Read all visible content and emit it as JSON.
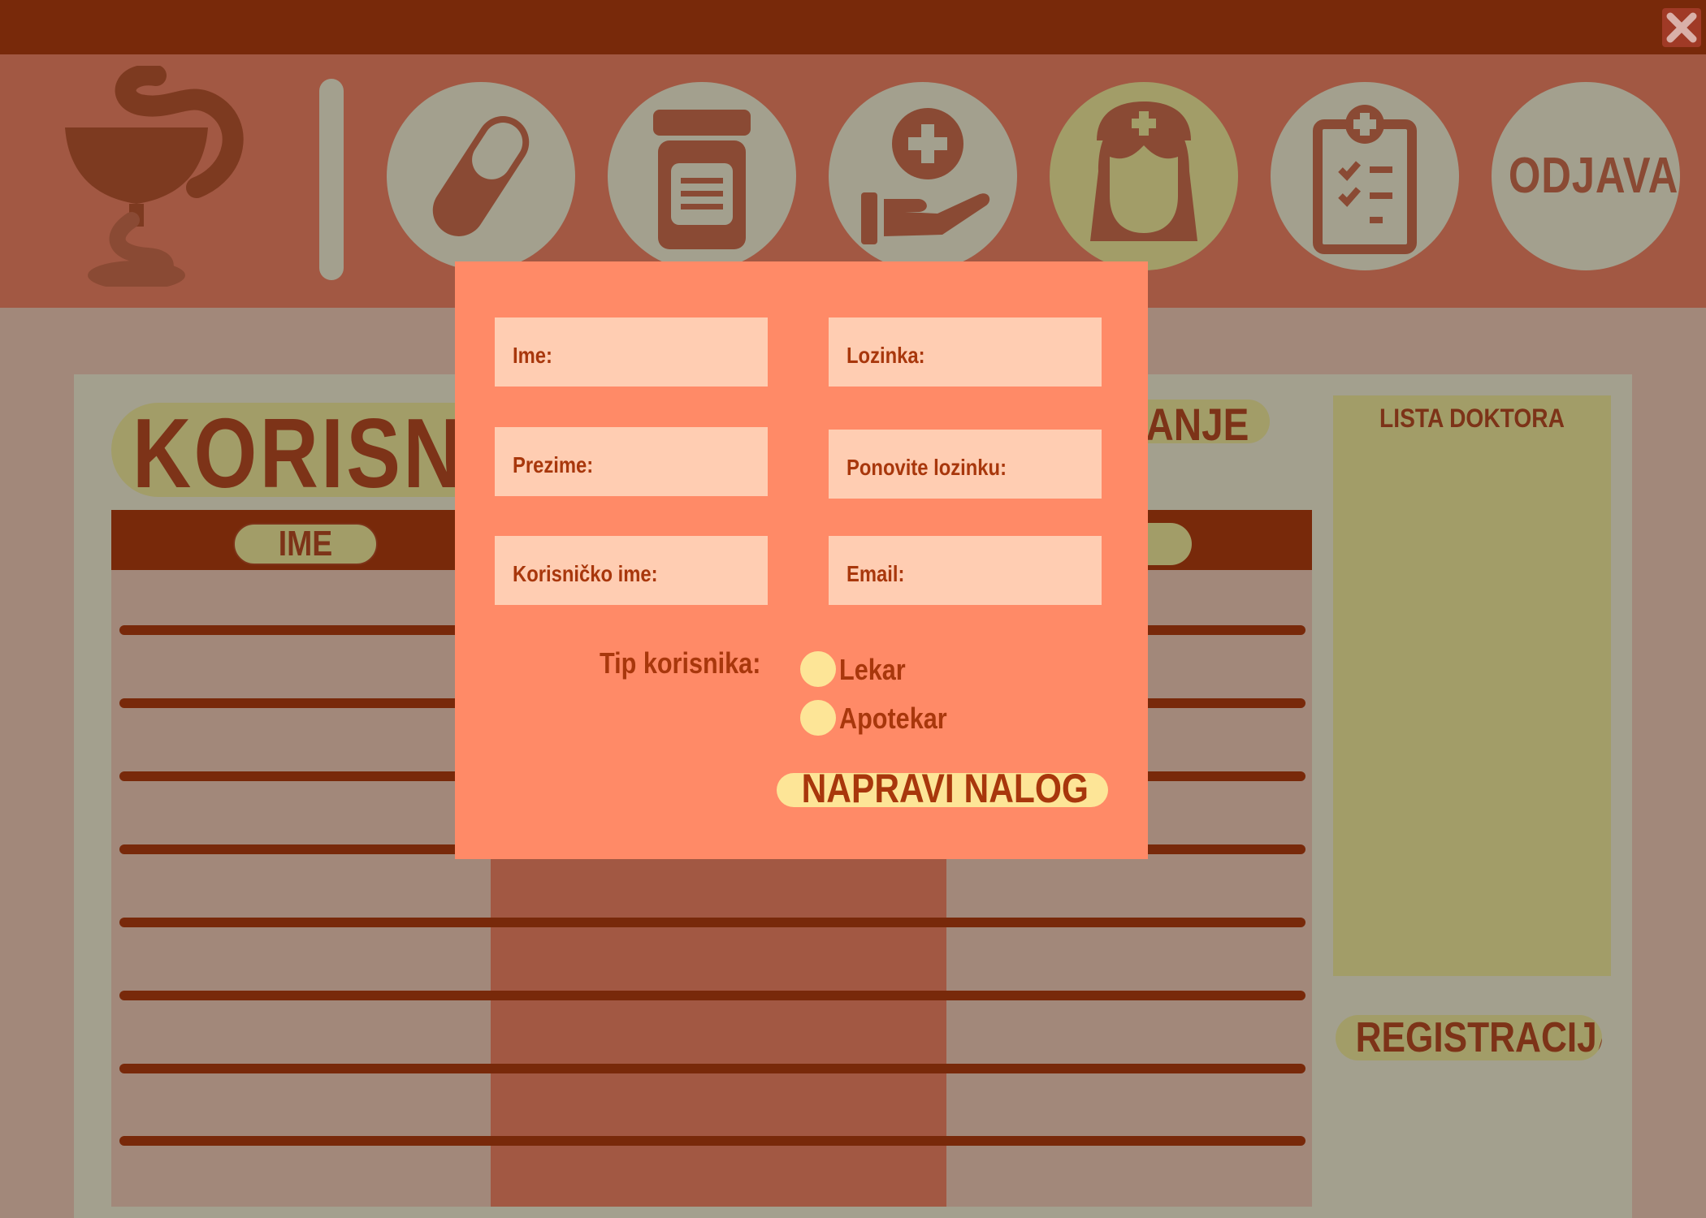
{
  "nav": {
    "logout_label": "ODJAVA",
    "items": [
      {
        "icon": "pill-icon"
      },
      {
        "icon": "medicine-jar-icon"
      },
      {
        "icon": "hand-with-cross-icon"
      },
      {
        "icon": "nurse-icon",
        "active": true
      },
      {
        "icon": "clipboard-checklist-icon"
      }
    ]
  },
  "page": {
    "title": "KORISN",
    "subtitle_fragment": "ANJE",
    "table_columns": [
      "IME",
      ""
    ],
    "doctors_title": "LISTA DOKTORA",
    "register_label": "REGISTRACIJA"
  },
  "modal": {
    "fields": {
      "first_name": "Ime:",
      "password": "Lozinka:",
      "last_name": "Prezime:",
      "repeat_password": "Ponovite lozinku:",
      "username": "Korisničko ime:",
      "email": "Email:"
    },
    "user_type_label": "Tip korisnika:",
    "options": [
      "Lekar",
      "Apotekar"
    ],
    "submit_label": "NAPRAVI NALOG"
  },
  "colors": {
    "topbar": "#78290a",
    "navbar": "#a25843",
    "modal_bg": "#ff8a67",
    "field_bg": "#ffcdb2",
    "accent_yellow": "#fde597",
    "text_dark_red": "#a8370c"
  }
}
